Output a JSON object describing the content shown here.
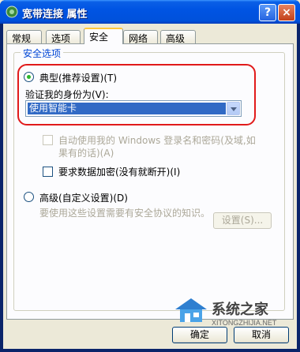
{
  "window": {
    "title": "宽带连接 属性",
    "help_label": "?",
    "close_label": "×"
  },
  "tabs": [
    {
      "label": "常规"
    },
    {
      "label": "选项"
    },
    {
      "label": "安全"
    },
    {
      "label": "网络"
    },
    {
      "label": "高级"
    }
  ],
  "security": {
    "group_label": "安全选项",
    "typical_label": "典型(推荐设置)(T)",
    "verify_label": "验证我的身份为(V):",
    "identity_value": "使用智能卡",
    "auto_logon_line1": "自动使用我的 Windows 登录名和密码(及域,如",
    "auto_logon_line2": "果有的话)(A)",
    "require_encryption": "要求数据加密(没有就断开)(I)",
    "advanced_label": "高级(自定义设置)(D)",
    "advanced_desc": "要使用这些设置需要有安全协议的知识。",
    "settings_button": "设置(S)..."
  },
  "watermark": {
    "brand": "系统之家",
    "url": "XITONGZHIJIA.NET"
  },
  "footer": {
    "ok": "确定",
    "cancel": "取消"
  },
  "colors": {
    "accent": "#316ac5",
    "highlight_ring": "#e11a1a",
    "group_label": "#0046d5"
  }
}
